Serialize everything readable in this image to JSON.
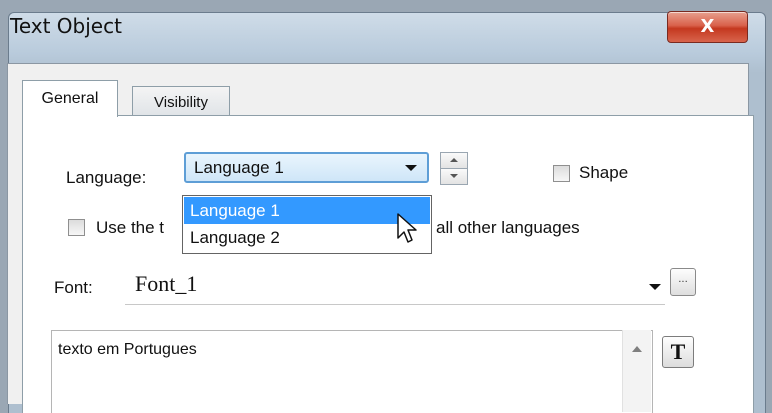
{
  "window": {
    "title": "Text Object",
    "close_glyph": "X"
  },
  "tabs": [
    {
      "label": "General"
    },
    {
      "label": "Visibility"
    }
  ],
  "language": {
    "label": "Language:",
    "selected": "Language 1",
    "options": [
      "Language 1",
      "Language 2"
    ]
  },
  "shape": {
    "label": "Shape"
  },
  "use_same": {
    "label_start": "Use the t",
    "label_end": "all other languages"
  },
  "font": {
    "label": "Font:",
    "value": "Font_1",
    "browse_label": "..."
  },
  "text": {
    "value": "texto em Portugues"
  },
  "t_button": {
    "label": "T"
  },
  "colors": {
    "selection": "#3399ff",
    "close_button": "#c4381f",
    "combo_border": "#5e9ed6"
  }
}
